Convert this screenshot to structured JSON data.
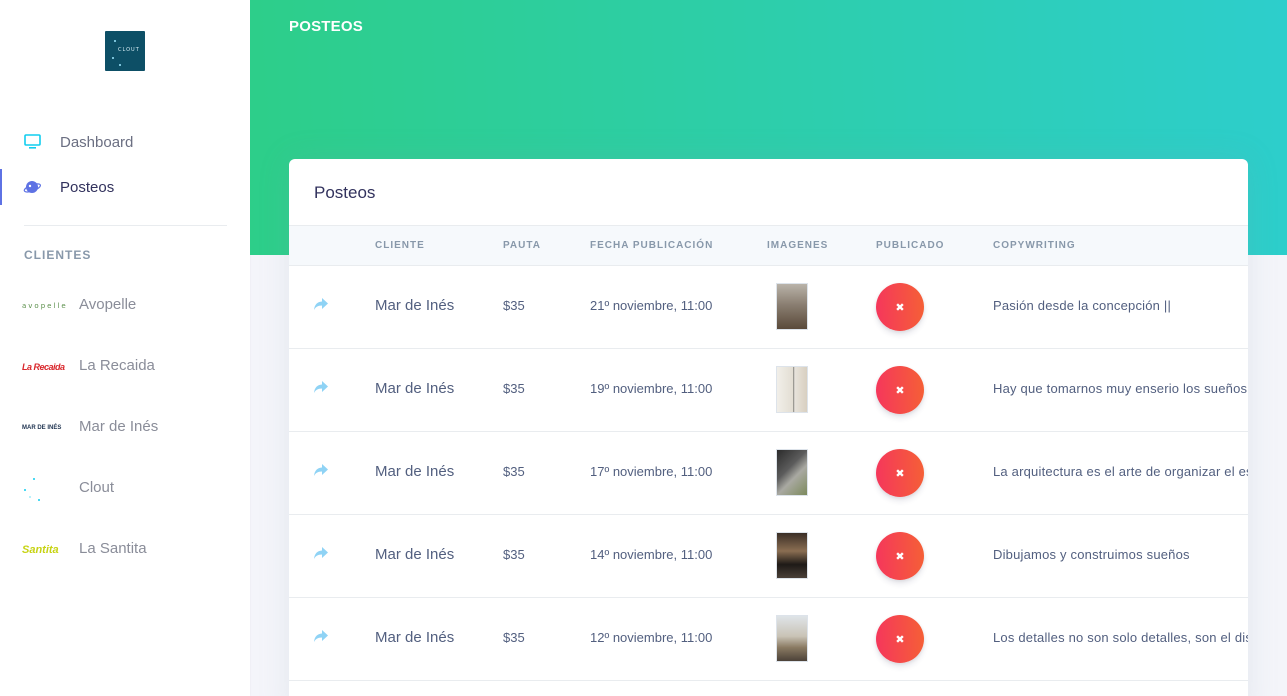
{
  "sidebar": {
    "logo_text": "CLOUT",
    "nav": [
      {
        "label": "Dashboard",
        "icon": "monitor-icon"
      },
      {
        "label": "Posteos",
        "icon": "planet-icon"
      }
    ],
    "section_title": "CLIENTES",
    "clients": [
      {
        "label": "Avopelle",
        "logo_text": "avopelle"
      },
      {
        "label": "La Recaida",
        "logo_text": "La Recaida"
      },
      {
        "label": "Mar de Inés",
        "logo_text": "MAR DE INÉS"
      },
      {
        "label": "Clout",
        "logo_text": ""
      },
      {
        "label": "La Santita",
        "logo_text": "Santita"
      }
    ]
  },
  "header": {
    "title": "POSTEOS"
  },
  "card": {
    "title": "Posteos",
    "columns": [
      "",
      "Cliente",
      "Pauta",
      "Fecha publicación",
      "Imagenes",
      "Publicado",
      "Copywriting"
    ],
    "rows": [
      {
        "cliente": "Mar de Inés",
        "pauta": "$35",
        "fecha": "21º noviembre, 11:00",
        "publicado": "✖",
        "copy": "Pasión desde la concepción ||"
      },
      {
        "cliente": "Mar de Inés",
        "pauta": "$35",
        "fecha": "19º noviembre, 11:00",
        "publicado": "✖",
        "copy": "Hay que tomarnos muy enserio los sueños"
      },
      {
        "cliente": "Mar de Inés",
        "pauta": "$35",
        "fecha": "17º noviembre, 11:00",
        "publicado": "✖",
        "copy": "La arquitectura es el arte de organizar el espacio"
      },
      {
        "cliente": "Mar de Inés",
        "pauta": "$35",
        "fecha": "14º noviembre, 11:00",
        "publicado": "✖",
        "copy": "Dibujamos y construimos sueños"
      },
      {
        "cliente": "Mar de Inés",
        "pauta": "$35",
        "fecha": "12º noviembre, 11:00",
        "publicado": "✖",
        "copy": "Los detalles no son solo detalles, son el diseño"
      }
    ]
  },
  "colors": {
    "header_start": "#2dce89",
    "header_end": "#2dcecc",
    "active_accent": "#5e72e4",
    "unpublished_start": "#f5365c",
    "unpublished_end": "#f56036"
  }
}
